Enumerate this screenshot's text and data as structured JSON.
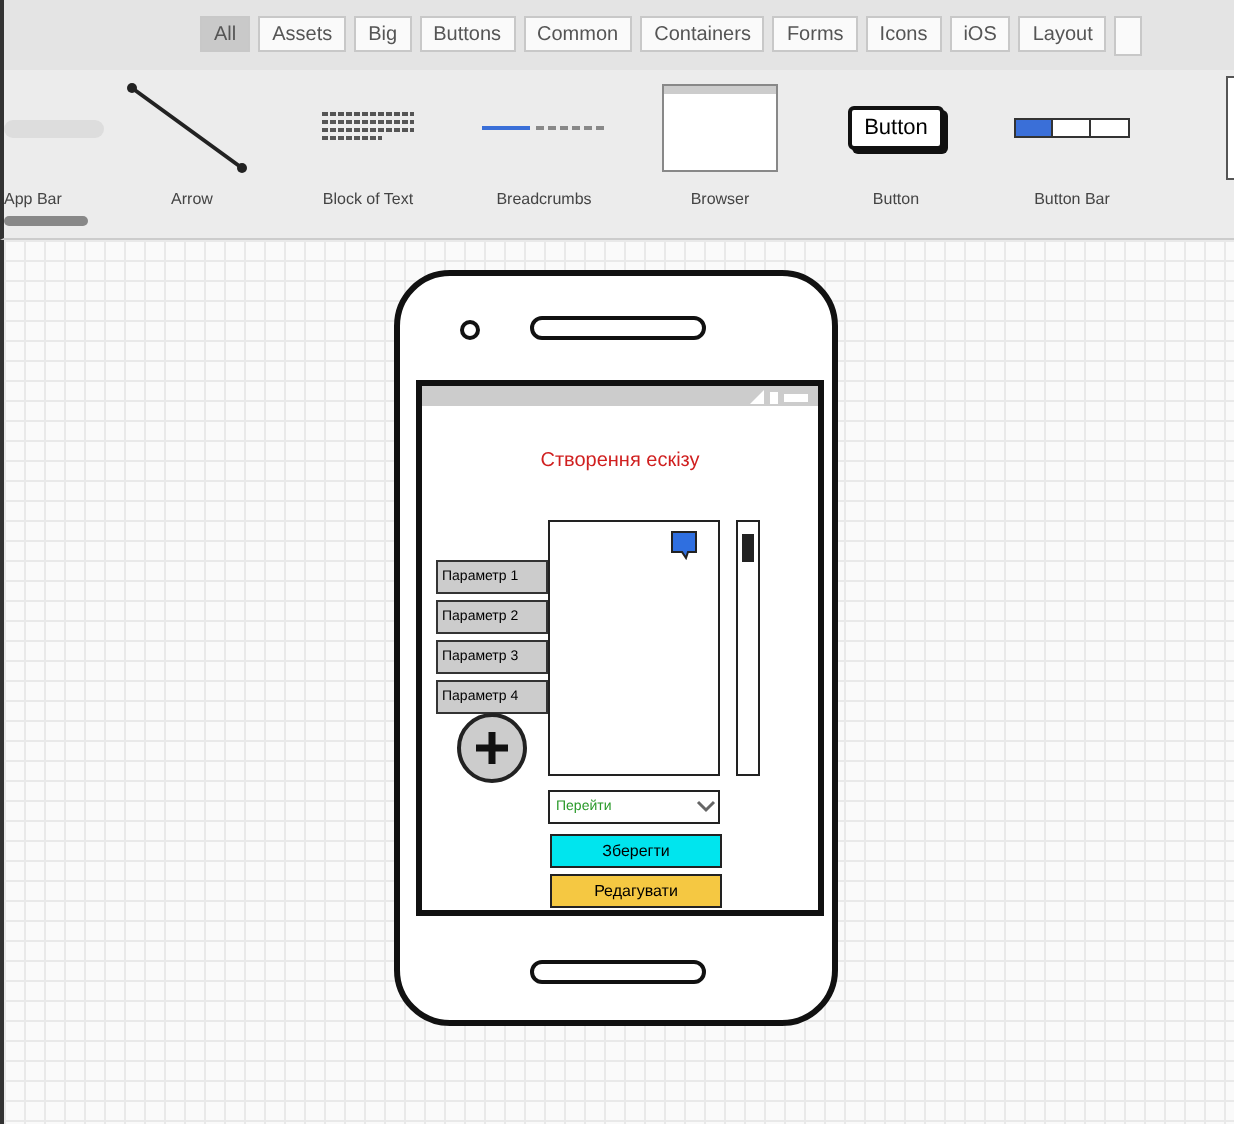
{
  "tabs": [
    {
      "label": "All",
      "selected": true
    },
    {
      "label": "Assets",
      "selected": false
    },
    {
      "label": "Big",
      "selected": false
    },
    {
      "label": "Buttons",
      "selected": false
    },
    {
      "label": "Common",
      "selected": false
    },
    {
      "label": "Containers",
      "selected": false
    },
    {
      "label": "Forms",
      "selected": false
    },
    {
      "label": "Icons",
      "selected": false
    },
    {
      "label": "iOS",
      "selected": false
    },
    {
      "label": "Layout",
      "selected": false
    }
  ],
  "palette": [
    {
      "kind": "appbar",
      "label": "App Bar"
    },
    {
      "kind": "arrow",
      "label": "Arrow"
    },
    {
      "kind": "text",
      "label": "Block of Text"
    },
    {
      "kind": "breadcrumbs",
      "label": "Breadcrumbs"
    },
    {
      "kind": "browser",
      "label": "Browser"
    },
    {
      "kind": "button",
      "label": "Button",
      "caption": "Button"
    },
    {
      "kind": "buttonbar",
      "label": "Button Bar"
    },
    {
      "kind": "partial"
    }
  ],
  "mockup": {
    "title": "Створення ескізу",
    "parameters": [
      "Параметр 1",
      "Параметр 2",
      "Параметр 3",
      "Параметр 4"
    ],
    "field": {
      "value": "Перейти"
    },
    "buttons": [
      {
        "label": "Зберегти",
        "color": "#00e5ee"
      },
      {
        "label": "Редагувати",
        "color": "#f5c842"
      }
    ]
  }
}
